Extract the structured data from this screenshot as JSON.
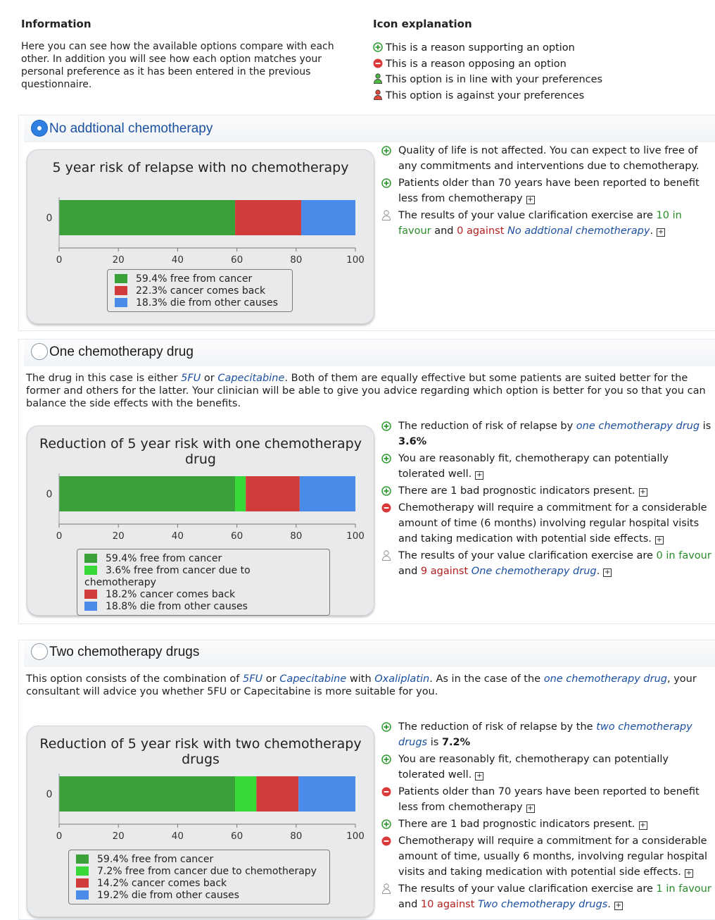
{
  "information": {
    "heading": "Information",
    "text": "Here you can see how the available options compare with each other. In addition you will see how each option matches your personal preference as it has been entered in the previous questionnaire."
  },
  "icon_explanation": {
    "heading": "Icon explanation",
    "items": [
      {
        "icon": "plus-circle-icon",
        "color": "#2e9a2e",
        "text": "This is a reason supporting an option"
      },
      {
        "icon": "minus-circle-icon",
        "color": "#d83a3a",
        "text": "This is a reason opposing an option"
      },
      {
        "icon": "person-green-icon",
        "color": "#4fb845",
        "text": "This option is in line with your preferences"
      },
      {
        "icon": "person-red-icon",
        "color": "#e04a3a",
        "text": "This option is against your preferences"
      }
    ]
  },
  "colors": {
    "free": "#3aa13a",
    "free_chemo": "#38d838",
    "comes_back": "#d23b3b",
    "other_causes": "#4a8ae8"
  },
  "options": [
    {
      "title": "No addtional chemotherapy",
      "selected": true,
      "description": [],
      "reasons": [
        {
          "type": "for",
          "parts": [
            {
              "t": "Quality of life is not affected. You can expect to live free of any commitments and interventions due to chemotherapy."
            }
          ],
          "expand": false
        },
        {
          "type": "for",
          "parts": [
            {
              "t": "Patients older than 70 years have been reported to benefit less from chemotherapy"
            }
          ],
          "expand": true
        },
        {
          "type": "pref",
          "parts": [
            {
              "t": "The results of your value clarification exercise are "
            },
            {
              "t": "10 in favour",
              "c": "hl-green"
            },
            {
              "t": " and "
            },
            {
              "t": "0 against",
              "c": "hl-red"
            },
            {
              "t": " "
            },
            {
              "t": "No addtional chemotherapy",
              "c": "hl-link"
            },
            {
              "t": "."
            }
          ],
          "expand": true
        }
      ],
      "chart_data": {
        "type": "bar",
        "orientation": "horizontal-stacked",
        "title": "5 year risk of relapse with no chemotherapy",
        "categories": [
          "0"
        ],
        "xlim": [
          0,
          100
        ],
        "xticks": [
          0,
          20,
          40,
          60,
          80,
          100
        ],
        "series": [
          {
            "name": "59.4% free from cancer",
            "key": "free",
            "values": [
              59.4
            ]
          },
          {
            "name": "22.3% cancer comes back",
            "key": "comes_back",
            "values": [
              22.3
            ]
          },
          {
            "name": "18.3% die from other causes",
            "key": "other_causes",
            "values": [
              18.3
            ]
          }
        ]
      }
    },
    {
      "title": "One chemotherapy drug",
      "selected": false,
      "description": [
        {
          "t": "The drug in this case is either "
        },
        {
          "t": "5FU",
          "c": "hl-link"
        },
        {
          "t": " or "
        },
        {
          "t": "Capecitabine",
          "c": "hl-link"
        },
        {
          "t": ". Both of them are equally effective but some patients are suited better for the former and others for the latter. Your clinician will be able to give you advice regarding which option is better for you so that you can balance the side effects with the benefits."
        }
      ],
      "reasons": [
        {
          "type": "for",
          "parts": [
            {
              "t": "The reduction of risk of relapse by "
            },
            {
              "t": "one chemotherapy drug",
              "c": "hl-link"
            },
            {
              "t": " is "
            },
            {
              "t": "3.6%",
              "c": "bold"
            }
          ],
          "expand": false
        },
        {
          "type": "for",
          "parts": [
            {
              "t": "You are reasonably fit, chemotherapy can potentially tolerated well."
            }
          ],
          "expand": true
        },
        {
          "type": "for",
          "parts": [
            {
              "t": "There are 1 bad prognostic indicators present."
            }
          ],
          "expand": true
        },
        {
          "type": "against",
          "parts": [
            {
              "t": "Chemotherapy will require a commitment for a considerable amount of time (6 months) involving regular hospital visits and taking medication with potential side effects."
            }
          ],
          "expand": true
        },
        {
          "type": "pref",
          "parts": [
            {
              "t": "The results of your value clarification exercise are "
            },
            {
              "t": "0 in favour",
              "c": "hl-green"
            },
            {
              "t": " and "
            },
            {
              "t": "9 against",
              "c": "hl-red"
            },
            {
              "t": " "
            },
            {
              "t": "One chemotherapy drug",
              "c": "hl-link"
            },
            {
              "t": "."
            }
          ],
          "expand": true
        }
      ],
      "chart_data": {
        "type": "bar",
        "orientation": "horizontal-stacked",
        "title": "Reduction of 5 year risk with one chemotherapy drug",
        "categories": [
          "0"
        ],
        "xlim": [
          0,
          100
        ],
        "xticks": [
          0,
          20,
          40,
          60,
          80,
          100
        ],
        "series": [
          {
            "name": "59.4% free from cancer",
            "key": "free",
            "values": [
              59.4
            ]
          },
          {
            "name": "3.6% free from cancer due to chemotherapy",
            "key": "free_chemo",
            "values": [
              3.6
            ]
          },
          {
            "name": "18.2% cancer comes back",
            "key": "comes_back",
            "values": [
              18.2
            ]
          },
          {
            "name": "18.8% die from other causes",
            "key": "other_causes",
            "values": [
              18.8
            ]
          }
        ]
      }
    },
    {
      "title": "Two chemotherapy drugs",
      "selected": false,
      "description": [
        {
          "t": "This option consists of the combination of "
        },
        {
          "t": "5FU",
          "c": "hl-link"
        },
        {
          "t": " or "
        },
        {
          "t": "Capecitabine",
          "c": "hl-link"
        },
        {
          "t": " with "
        },
        {
          "t": "Oxaliplatin",
          "c": "hl-link"
        },
        {
          "t": ". As in the case of the "
        },
        {
          "t": "one chemotherapy drug",
          "c": "hl-link"
        },
        {
          "t": ", your consultant will advice you whether 5FU or Capecitabine is more suitable for you."
        }
      ],
      "reasons": [
        {
          "type": "for",
          "parts": [
            {
              "t": "The reduction of risk of relapse by the "
            },
            {
              "t": "two chemotherapy drugs",
              "c": "hl-link"
            },
            {
              "t": " is "
            },
            {
              "t": "7.2%",
              "c": "bold"
            }
          ],
          "expand": false
        },
        {
          "type": "for",
          "parts": [
            {
              "t": "You are reasonably fit, chemotherapy can potentially tolerated well."
            }
          ],
          "expand": true
        },
        {
          "type": "against",
          "parts": [
            {
              "t": "Patients older than 70 years have been reported to benefit less from chemotherapy"
            }
          ],
          "expand": true
        },
        {
          "type": "for",
          "parts": [
            {
              "t": "There are 1 bad prognostic indicators present."
            }
          ],
          "expand": true
        },
        {
          "type": "against",
          "parts": [
            {
              "t": "Chemotherapy will require a commitment for a considerable amount of time, usually 6 months, involving regular hospital visits and taking medication with potential side effects."
            }
          ],
          "expand": true
        },
        {
          "type": "pref",
          "parts": [
            {
              "t": "The results of your value clarification exercise are "
            },
            {
              "t": "1 in favour",
              "c": "hl-green"
            },
            {
              "t": " and "
            },
            {
              "t": "10 against",
              "c": "hl-red"
            },
            {
              "t": " "
            },
            {
              "t": "Two chemotherapy drugs",
              "c": "hl-link"
            },
            {
              "t": "."
            }
          ],
          "expand": true
        }
      ],
      "chart_data": {
        "type": "bar",
        "orientation": "horizontal-stacked",
        "title": "Reduction of 5 year risk with two chemotherapy drugs",
        "categories": [
          "0"
        ],
        "xlim": [
          0,
          100
        ],
        "xticks": [
          0,
          20,
          40,
          60,
          80,
          100
        ],
        "series": [
          {
            "name": "59.4% free from cancer",
            "key": "free",
            "values": [
              59.4
            ]
          },
          {
            "name": "7.2% free from cancer due to chemotherapy",
            "key": "free_chemo",
            "values": [
              7.2
            ]
          },
          {
            "name": "14.2% cancer comes back",
            "key": "comes_back",
            "values": [
              14.2
            ]
          },
          {
            "name": "19.2% die from other causes",
            "key": "other_causes",
            "values": [
              19.2
            ]
          }
        ]
      }
    }
  ]
}
